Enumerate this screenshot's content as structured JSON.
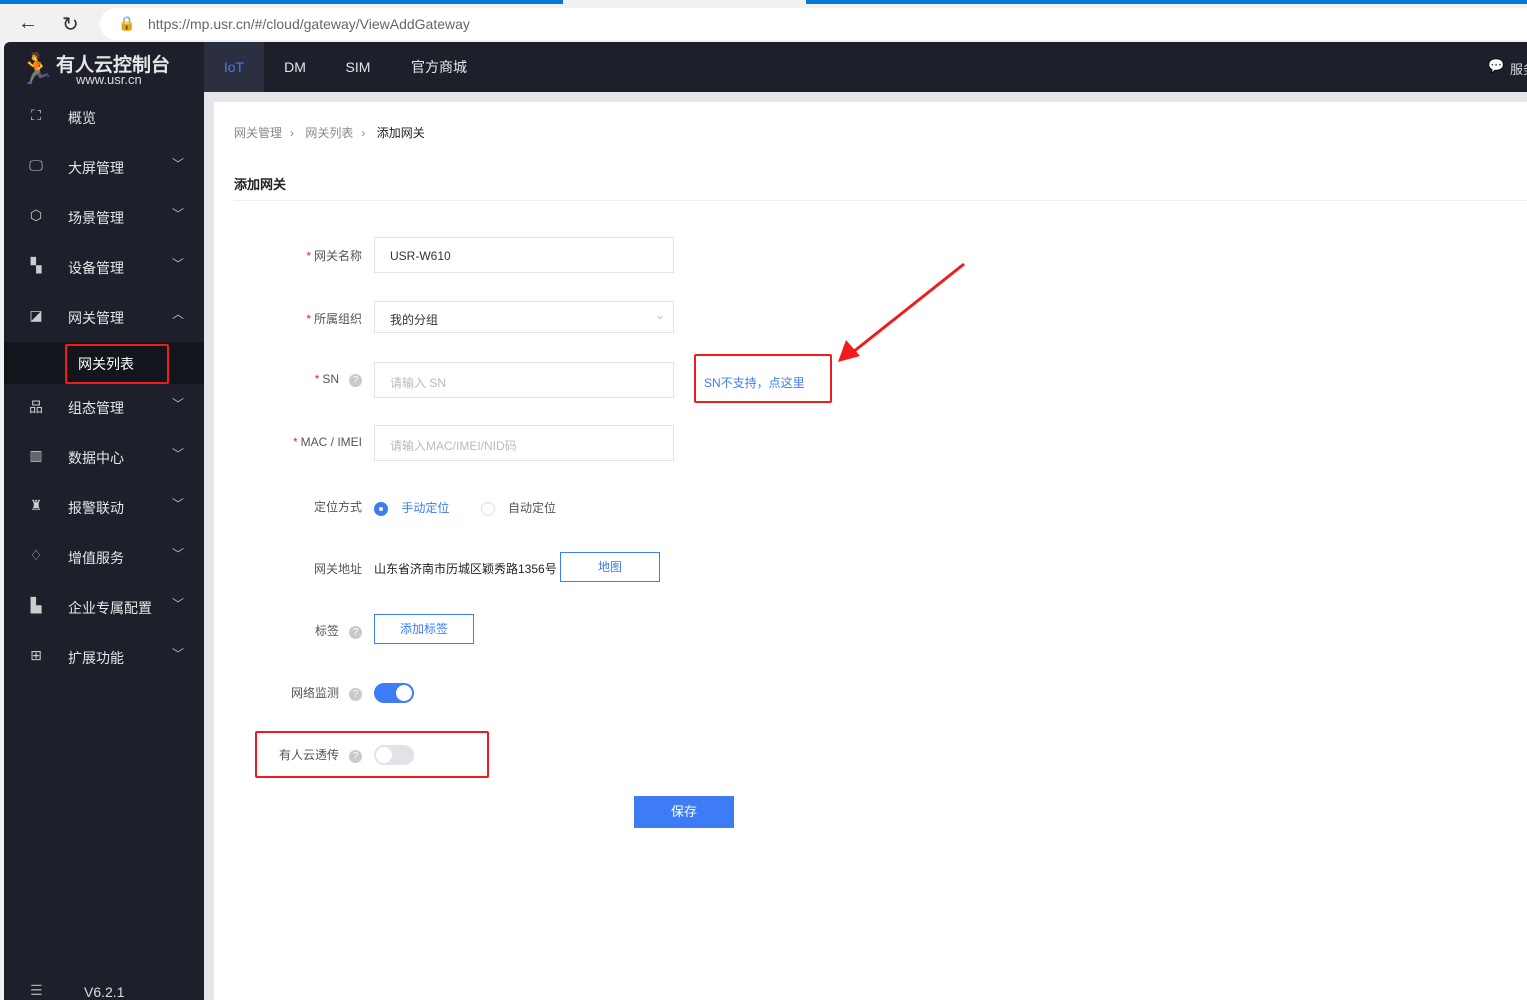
{
  "browser": {
    "url": "https://mp.usr.cn/#/cloud/gateway/ViewAddGateway"
  },
  "brand": {
    "name": "有人云控制台",
    "site": "www.usr.cn"
  },
  "topnav": {
    "tabs": [
      {
        "label": "IoT",
        "active": true
      },
      {
        "label": "DM"
      },
      {
        "label": "SIM"
      },
      {
        "label": "官方商城"
      }
    ],
    "service": "服务"
  },
  "sidebar": {
    "items": [
      {
        "label": "概览",
        "icon": "overview-icon"
      },
      {
        "label": "大屏管理",
        "icon": "screen-icon"
      },
      {
        "label": "场景管理",
        "icon": "cube-icon"
      },
      {
        "label": "设备管理",
        "icon": "device-icon"
      },
      {
        "label": "网关管理",
        "icon": "gateway-icon",
        "expanded": true
      },
      {
        "label": "组态管理",
        "icon": "topology-icon"
      },
      {
        "label": "数据中心",
        "icon": "bar-chart-icon"
      },
      {
        "label": "报警联动",
        "icon": "alarm-icon"
      },
      {
        "label": "增值服务",
        "icon": "diamond-icon"
      },
      {
        "label": "企业专属配置",
        "icon": "building-icon"
      },
      {
        "label": "扩展功能",
        "icon": "grid-icon"
      }
    ],
    "subitem": "网关列表",
    "version": "V6.2.1"
  },
  "breadcrumb": [
    "网关管理",
    "网关列表",
    "添加网关"
  ],
  "page": {
    "title": "添加网关"
  },
  "form": {
    "name_label": "网关名称",
    "name_value": "USR-W610",
    "org_label": "所属组织",
    "org_value": "我的分组",
    "sn_label": "SN",
    "sn_placeholder": "请输入 SN",
    "sn_link": "SN不支持，点这里",
    "mac_label": "MAC / IMEI",
    "mac_placeholder": "请输入MAC/IMEI/NID码",
    "loc_label": "定位方式",
    "loc_manual": "手动定位",
    "loc_auto": "自动定位",
    "loc_selected": "手动定位",
    "addr_label": "网关地址",
    "addr_value": "山东省济南市历城区颖秀路1356号",
    "map_button": "地图",
    "tag_label": "标签",
    "tag_button": "添加标签",
    "net_label": "网络监测",
    "net_on": true,
    "trans_label": "有人云透传",
    "trans_on": false,
    "save": "保存"
  },
  "colors": {
    "accent": "#3d7cf5",
    "sidebar": "#1d202a",
    "annotation": "#f21b1b"
  }
}
